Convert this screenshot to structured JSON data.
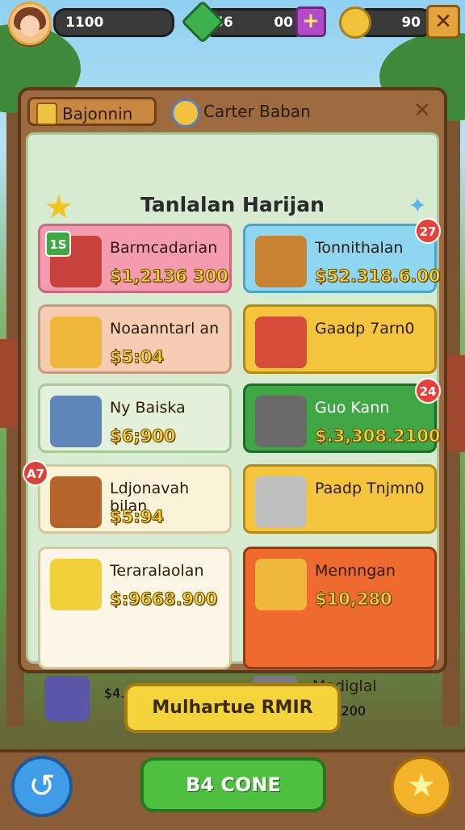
{
  "topbar": {
    "player_value": "1100",
    "gems": "56",
    "gems_extra": "00",
    "plus_label": "+",
    "coins": "90",
    "close_label": "✕"
  },
  "panel": {
    "tab1_label": "Bajonnin",
    "tab2_label": "Carter Baban",
    "close_label": "✕",
    "title": "Tanlalan Harijan"
  },
  "cards": [
    {
      "title": "Barmcadarian",
      "price": "$1,2136 300",
      "badge": "1S",
      "bg": "#f49bb0",
      "border": "#c96a7f"
    },
    {
      "title": "Tonnithalan",
      "price": "$52.318.6.00",
      "badge": "27",
      "bg": "#8fd6f0",
      "border": "#4aa6c8"
    },
    {
      "title": "Noaanntarl an",
      "price": "$5:04",
      "badge": "",
      "bg": "#f6cdb2",
      "border": "#c99b7e"
    },
    {
      "title": "Gaadp 7arn0",
      "price": "",
      "badge": "",
      "bg": "#f4c53d",
      "border": "#b58a12"
    },
    {
      "title": "Ny Baiska",
      "price": "$6;900",
      "badge": "",
      "bg": "#e3f0da",
      "border": "#a7c99a"
    },
    {
      "title": "Guo Kann",
      "price": "$.3,308.2100",
      "badge": "24",
      "bg": "#3fa845",
      "border": "#1e6a2a"
    },
    {
      "title": "Ldjonavah bilan",
      "price": "$5:94",
      "badge": "A7",
      "bg": "#fbf3d8",
      "border": "#d6c79a"
    },
    {
      "title": "Paadp Tnjmn0",
      "price": "",
      "badge": "",
      "bg": "#f4c53d",
      "border": "#b58a12"
    },
    {
      "title": "Teraralaolan",
      "price": "$:9668.900",
      "badge": "",
      "bg": "#fbf6e6",
      "border": "#d6c79a"
    },
    {
      "title": "Mennngan",
      "price": "$10,280",
      "badge": "",
      "bg": "#ef6a2f",
      "border": "#9a3a12"
    },
    {
      "title": "",
      "price": "$4.800",
      "badge": "",
      "bg": "#fbf6e6",
      "border": "#d6c79a"
    },
    {
      "title": "Madiglal",
      "price": "$10,200",
      "badge": "",
      "bg": "#ef6a2f",
      "border": "#9a3a12"
    }
  ],
  "buttons": {
    "main": "Mulhartue RMIR",
    "go": "B4 CONE",
    "back_icon": "↺",
    "star_icon": "★"
  }
}
